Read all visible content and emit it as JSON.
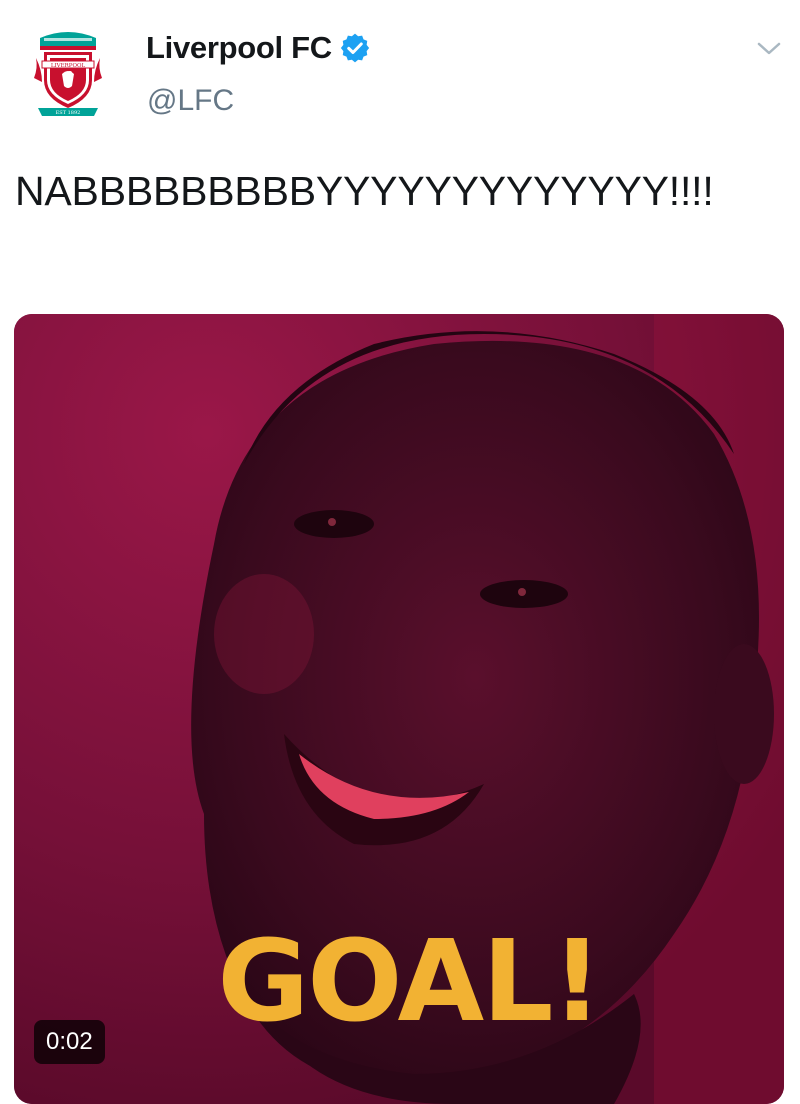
{
  "account": {
    "display_name": "Liverpool FC",
    "handle": "@LFC",
    "verified": true,
    "avatar_icon": "liverpool-crest-icon"
  },
  "tweet": {
    "text": "NABBBBBBBBBYYYYYYYYYYYYY!!!!"
  },
  "media": {
    "overlay_text": "GOAL!",
    "duration": "0:02",
    "overlay_color": "#f2b233",
    "background_color": "#6e0c34"
  },
  "colors": {
    "verified_badge": "#1da1f2",
    "crest_red": "#c8102e",
    "crest_green": "#00a398"
  }
}
